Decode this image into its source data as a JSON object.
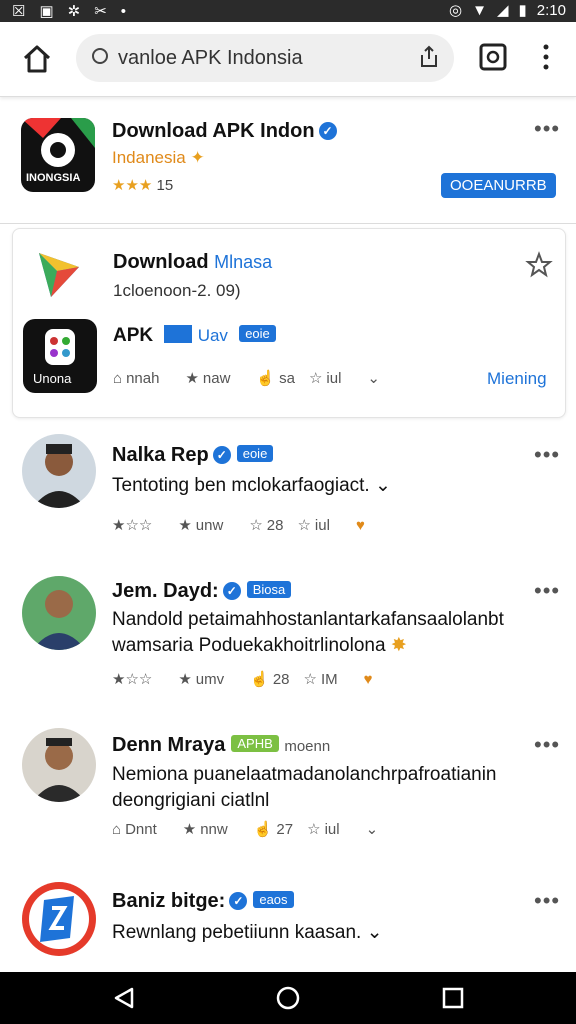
{
  "status_bar": {
    "time": "2:10"
  },
  "browser": {
    "url": "vanloe APK Indonsia"
  },
  "top_app": {
    "title": "Download APK Indon",
    "subtitle": "Indanesia",
    "rating": "15",
    "icon_text": "INONGSIA",
    "button": "OOEANURRB"
  },
  "featured": {
    "title": "Download",
    "title_accent": "Mlnasa",
    "version": "1cloenoon-2. 09)",
    "app_label": "APK",
    "badge_text": "Uav",
    "badge": "eoie",
    "icon_text": "Unona",
    "actions": [
      "nnah",
      "naw",
      "sa",
      "iul"
    ],
    "link": "Miening"
  },
  "posts": [
    {
      "name": "Nalka Rep",
      "badge": "eoie",
      "badge_color": "blue",
      "lines": [
        "Tentoting ben mclokarfaogiact."
      ],
      "actions": [
        "",
        "unw",
        "28",
        "iul"
      ]
    },
    {
      "name": "Jem. Dayd:",
      "badge": "Biosa",
      "badge_color": "blue",
      "lines": [
        "Nandold petaimahhostanlantarkafansaalolanbt",
        "wamsaria Poduekakhoitrlinolona"
      ],
      "actions": [
        "",
        "umv",
        "28",
        "IM"
      ]
    },
    {
      "name": "Denn Mraya",
      "badge": "APHB",
      "badge_color": "green",
      "extra": "moenn",
      "lines": [
        "Nemiona puanelaatmadanolanchrpafroatianin",
        "deongrigiani ciatlnl"
      ],
      "actions": [
        "Dnnt",
        "nnw",
        "27",
        "iul"
      ]
    },
    {
      "name": "Baniz bitge:",
      "badge": "eaos",
      "badge_color": "blue",
      "lines": [
        "Rewnlang pebetiiunn kaasan."
      ],
      "actions": []
    }
  ],
  "colors": {
    "accent": "#1e73d8",
    "verified": "#1e73d8",
    "star": "#f0a020"
  }
}
